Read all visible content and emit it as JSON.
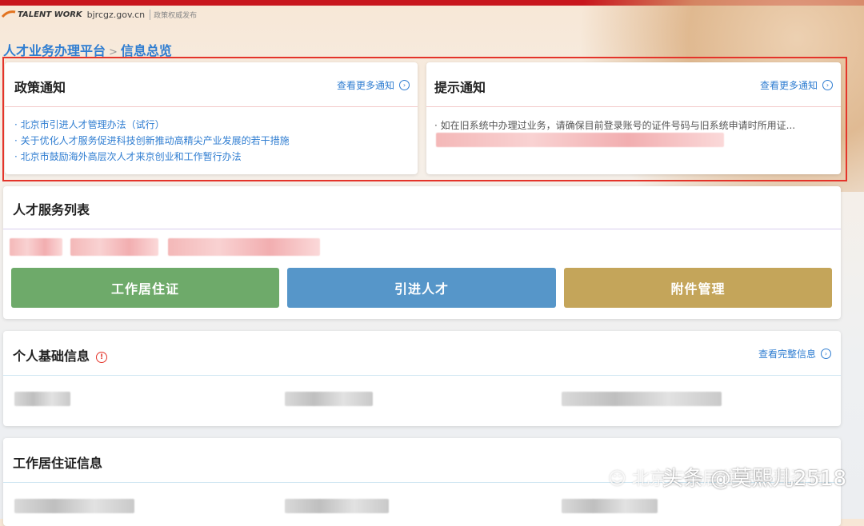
{
  "header": {
    "logo_text": "TALENT WORK",
    "domain": "bjrcgz.gov.cn",
    "slogan": "政策权威发布"
  },
  "breadcrumb": {
    "root": "人才业务办理平台",
    "separator": ">",
    "current": "信息总览"
  },
  "policy_notice": {
    "title": "政策通知",
    "more_label": "查看更多通知",
    "items": [
      "· 北京市引进人才管理办法（试行）",
      "· 关于优化人才服务促进科技创新推动高精尖产业发展的若干措施",
      "· 北京市鼓励海外高层次人才来京创业和工作暂行办法"
    ]
  },
  "tip_notice": {
    "title": "提示通知",
    "more_label": "查看更多通知",
    "text": "· 如在旧系统中办理过业务，请确保目前登录账号的证件号码与旧系统申请时所用证..."
  },
  "talent_services": {
    "title": "人才服务列表",
    "buttons": [
      {
        "label": "工作居住证",
        "color": "#6eaa6a"
      },
      {
        "label": "引进人才",
        "color": "#5696c9"
      },
      {
        "label": "附件管理",
        "color": "#c4a55a"
      }
    ]
  },
  "personal_info": {
    "title": "个人基础信息",
    "alert_icon": "info-circle-icon",
    "more_label": "查看完整信息"
  },
  "residence_permit_info": {
    "title": "工作居住证信息"
  },
  "watermark": {
    "account": "北京工作居住证办理咨询",
    "platform": "头条 @莫熙儿2518"
  },
  "colors": {
    "accent": "#2f7dd1",
    "highlight_border": "#e4342a",
    "top_bar": "#c8161d"
  }
}
